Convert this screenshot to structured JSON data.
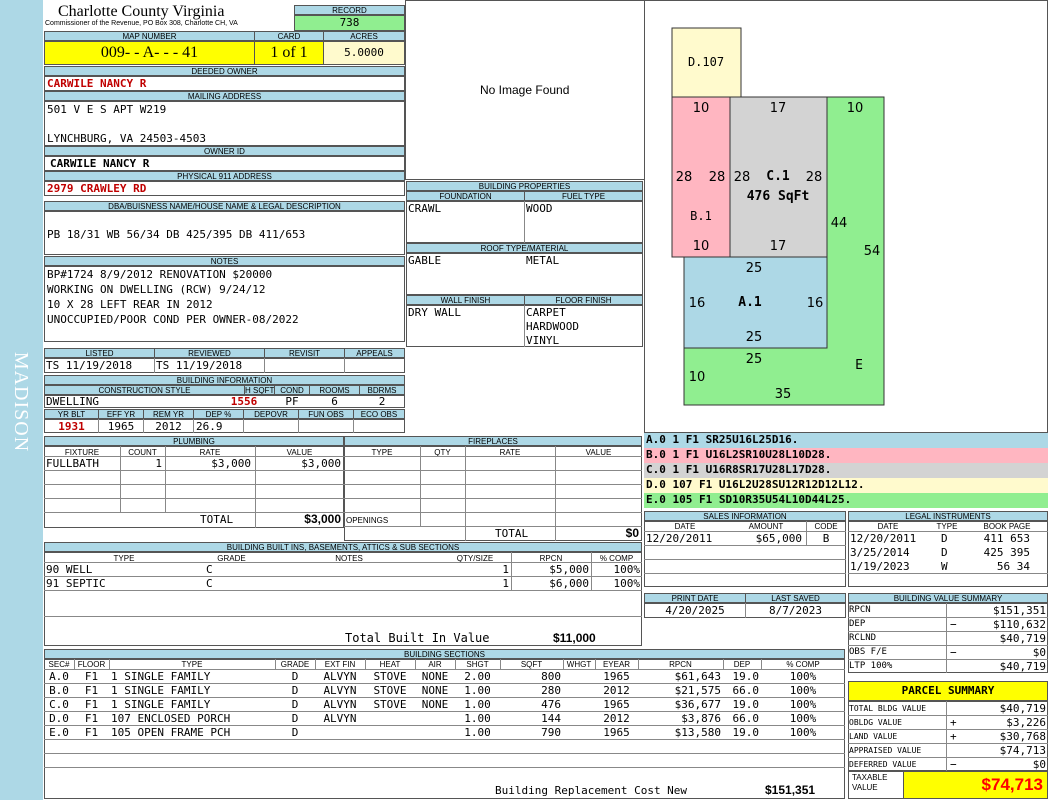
{
  "side_label": "MADISON",
  "header": {
    "county": "Charlotte County Virginia",
    "subtitle": "Commissioner of the Revenue, PO Box 308, Charlotte CH, VA",
    "record_label": "RECORD",
    "record": "738"
  },
  "parcel": {
    "map_label": "MAP NUMBER",
    "map": "009- - A- - - 41",
    "card_label": "CARD",
    "card": "1 of 1",
    "acres_label": "ACRES",
    "acres": "5.0000"
  },
  "owner": {
    "deeded_label": "DEEDED OWNER",
    "deeded": "CARWILE NANCY R",
    "mailing_label": "MAILING ADDRESS",
    "mail1": "501 V E S APT W219",
    "mail2": "LYNCHBURG, VA 24503-4503",
    "owner_id_label": "OWNER ID",
    "owner_id": "CARWILE NANCY R",
    "phys_label": "PHYSICAL 911 ADDRESS",
    "phys": "2979 CRAWLEY RD"
  },
  "legal": {
    "label": "DBA/BUISNESS NAME/HOUSE NAME & LEGAL DESCRIPTION",
    "text": "PB 18/31 WB 56/34 DB 425/395 DB 411/653"
  },
  "notes": {
    "label": "NOTES",
    "lines": [
      "BP#1724 8/9/2012 RENOVATION $20000",
      "WORKING ON DWELLING (RCW) 9/24/12",
      "10 X 28 LEFT REAR IN 2012",
      "UNOCCUPIED/POOR COND PER OWNER-08/2022"
    ]
  },
  "dates": {
    "listed_label": "LISTED",
    "listed": "TS   11/19/2018",
    "reviewed_label": "REVIEWED",
    "reviewed": "TS   11/19/2018",
    "revisit_label": "REVISIT",
    "appeals_label": "APPEALS"
  },
  "image": {
    "placeholder": "No Image Found"
  },
  "bprops": {
    "label": "BUILDING PROPERTIES",
    "foundation_label": "FOUNDATION",
    "fuel_label": "FUEL TYPE",
    "foundation": "CRAWL",
    "fuel": "WOOD",
    "roof_label": "ROOF TYPE/MATERIAL",
    "roof1": "GABLE",
    "roof2": "METAL",
    "wall_label": "WALL FINISH",
    "floor_label": "FLOOR FINISH",
    "wall": "DRY WALL",
    "floors": [
      "CARPET",
      "HARDWOOD",
      "VINYL"
    ]
  },
  "binfo": {
    "label": "BUILDING INFORMATION",
    "cs_label": "CONSTRUCTION STYLE",
    "hsqft_label": "H SQFT",
    "cond_label": "COND",
    "rooms_label": "ROOMS",
    "bdrms_label": "BDRMS",
    "cs": "DWELLING",
    "hsqft": "1556",
    "cond": "PF",
    "rooms": "6",
    "bdrms": "2",
    "yrblt_label": "YR BLT",
    "effyr_label": "EFF YR",
    "remyr_label": "REM YR",
    "dep_label": "DEP %",
    "depovr_label": "DEPOVR",
    "funobs_label": "FUN OBS",
    "ecoobs_label": "ECO OBS",
    "yrblt": "1931",
    "effyr": "1965",
    "remyr": "2012",
    "dep": "26.9"
  },
  "plumbing": {
    "label": "PLUMBING",
    "headers": [
      "FIXTURE",
      "COUNT",
      "RATE",
      "VALUE"
    ],
    "rows": [
      [
        "FULLBATH",
        "1",
        "$3,000",
        "$3,000"
      ]
    ],
    "total_label": "TOTAL",
    "total": "$3,000"
  },
  "fireplaces": {
    "label": "FIREPLACES",
    "headers": [
      "TYPE",
      "QTY",
      "RATE",
      "VALUE"
    ],
    "openings_label": "OPENINGS",
    "total_label": "TOTAL",
    "total": "$0"
  },
  "builtins": {
    "label": "BUILDING BUILT INS, BASEMENTS, ATTICS & SUB SECTIONS",
    "headers": [
      "TYPE",
      "GRADE",
      "NOTES",
      "QTY/SIZE",
      "RPCN",
      "% COMP"
    ],
    "rows": [
      [
        "90 WELL",
        "C",
        "",
        "1",
        "$5,000",
        "100%"
      ],
      [
        "91 SEPTIC",
        "C",
        "",
        "1",
        "$6,000",
        "100%"
      ]
    ],
    "total_label": "Total Built In Value",
    "total": "$11,000"
  },
  "sections": {
    "label": "BUILDING SECTIONS",
    "headers": [
      "SEC#",
      "FLOOR",
      "TYPE",
      "GRADE",
      "EXT FIN",
      "HEAT",
      "AIR",
      "SHGT",
      "SQFT",
      "WHGT",
      "EYEAR",
      "RPCN",
      "DEP",
      "% COMP"
    ],
    "rows": [
      [
        "A.0",
        "F1",
        "1 SINGLE FAMILY",
        "D",
        "ALVYN",
        "STOVE",
        "NONE",
        "2.00",
        "800",
        "",
        "1965",
        "$61,643",
        "19.0",
        "100%"
      ],
      [
        "B.0",
        "F1",
        "1 SINGLE FAMILY",
        "D",
        "ALVYN",
        "STOVE",
        "NONE",
        "1.00",
        "280",
        "",
        "2012",
        "$21,575",
        "66.0",
        "100%"
      ],
      [
        "C.0",
        "F1",
        "1 SINGLE FAMILY",
        "D",
        "ALVYN",
        "STOVE",
        "NONE",
        "1.00",
        "476",
        "",
        "1965",
        "$36,677",
        "19.0",
        "100%"
      ],
      [
        "D.0",
        "F1",
        "107 ENCLOSED PORCH",
        "D",
        "ALVYN",
        "",
        "",
        "1.00",
        "144",
        "",
        "2012",
        "$3,876",
        "66.0",
        "100%"
      ],
      [
        "E.0",
        "F1",
        "105 OPEN FRAME PCH",
        "D",
        "",
        "",
        "",
        "1.00",
        "790",
        "",
        "1965",
        "$13,580",
        "19.0",
        "100%"
      ]
    ],
    "repl_label": "Building Replacement Cost New",
    "repl": "$151,351"
  },
  "sketch": {
    "colors": {
      "D": "#fffacd",
      "B": "#ffb6c1",
      "C": "#d3d3d3",
      "A": "#add8e6",
      "E": "#90ee90"
    },
    "labels": {
      "d": "D.107",
      "b": "B.1",
      "c": "C.1",
      "csq": "476 SqFt",
      "a": "A.1",
      "e": "E"
    },
    "dims": {
      "b_top": "10",
      "b_left": "28",
      "b_right": "28",
      "b_bot": "10",
      "c_top": "17",
      "c_left": "28",
      "c_right": "28",
      "c_bot": "17",
      "e_top": "10",
      "e_mid": "44",
      "e_right": "54",
      "a_top": "25",
      "a_left": "16",
      "a_right": "16",
      "a_bot": "25",
      "e_in": "25",
      "e_left": "10",
      "e_bot": "35"
    }
  },
  "vectors": [
    {
      "t": "A.0   1     F1    SR25U16L25D16.",
      "color": "#add8e6"
    },
    {
      "t": "B.0   1     F1    U16L2SR10U28L10D28.",
      "color": "#ffb6c1"
    },
    {
      "t": "C.0   1     F1    U16R8SR17U28L17D28.",
      "color": "#d3d3d3"
    },
    {
      "t": "D.0   107   F1    U16L2U28SU12R12D12L12.",
      "color": "#fffacd"
    },
    {
      "t": "E.0   105   F1    SD10R35U54L10D44L25.",
      "color": "#90ee90"
    }
  ],
  "sales": {
    "label": "SALES INFORMATION",
    "headers": [
      "DATE",
      "AMOUNT",
      "CODE"
    ],
    "rows": [
      [
        "12/20/2011",
        "$65,000",
        "B"
      ]
    ]
  },
  "legal_inst": {
    "label": "LEGAL INSTRUMENTS",
    "headers": [
      "DATE",
      "TYPE",
      "BOOK PAGE"
    ],
    "rows": [
      [
        "12/20/2011",
        "D",
        "411 653"
      ],
      [
        "3/25/2014",
        "D",
        "425 395"
      ],
      [
        "1/19/2023",
        "W",
        "56 34"
      ]
    ]
  },
  "print": {
    "print_label": "PRINT DATE",
    "print": "4/20/2025",
    "saved_label": "LAST SAVED",
    "saved": "8/7/2023"
  },
  "bvs": {
    "label": "BUILDING VALUE SUMMARY",
    "rows": [
      [
        "RPCN",
        "",
        "$151,351"
      ],
      [
        "DEP",
        "−",
        "$110,632"
      ],
      [
        "RCLND",
        "",
        "$40,719"
      ],
      [
        "OBS F/E",
        "−",
        "$0"
      ],
      [
        "LTP   100%",
        "",
        "$40,719"
      ]
    ]
  },
  "summary": {
    "label": "PARCEL SUMMARY",
    "rows": [
      [
        "TOTAL BLDG VALUE",
        "",
        "$40,719"
      ],
      [
        "OBLDG VALUE",
        "+",
        "$3,226"
      ],
      [
        "LAND VALUE",
        "+",
        "$30,768"
      ],
      [
        "APPRAISED VALUE",
        "",
        "$74,713"
      ],
      [
        "DEFERRED VALUE",
        "−",
        "$0"
      ]
    ],
    "taxable_label": "TAXABLE VALUE",
    "taxable": "$74,713"
  }
}
